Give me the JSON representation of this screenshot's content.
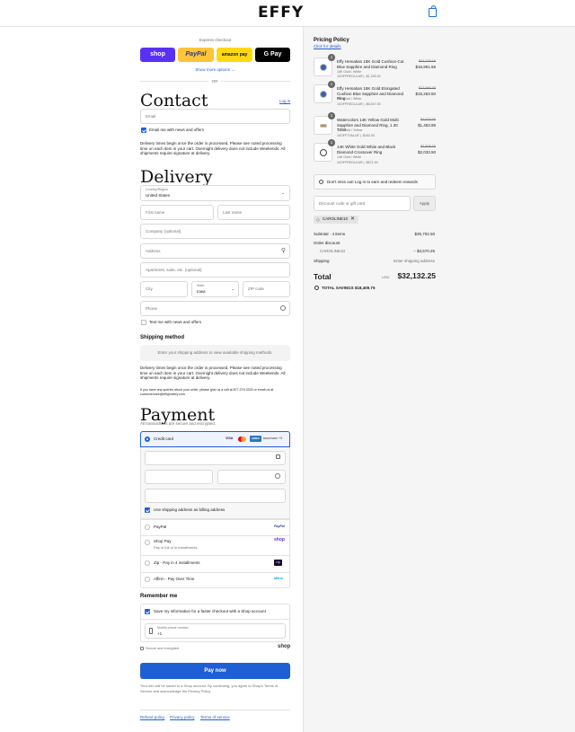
{
  "header": {
    "logo": "EFFY",
    "bag_icon": "bag-icon"
  },
  "express": {
    "title": "Express checkout",
    "buttons": [
      "shop",
      "PayPal",
      "amazon pay",
      "G Pay"
    ],
    "show_more": "Show more options →",
    "or": "OR"
  },
  "contact": {
    "title": "Contact",
    "login": "Log in",
    "email_placeholder": "Email",
    "news_label": "Email me with news and offers",
    "delivery_note": "Delivery times begin once the order is processed. Please see noted processing time on each item in your cart. Overnight delivery does not include Weekends. All shipments require signature at delivery."
  },
  "delivery": {
    "title": "Delivery",
    "country_label": "Country/Region",
    "country_value": "United States",
    "first_name": "First name",
    "last_name": "Last name",
    "company": "Company (optional)",
    "address": "Address",
    "apartment": "Apartment, suite, etc. (optional)",
    "city": "City",
    "state_label": "State",
    "state_value": "Iowa",
    "zip": "ZIP code",
    "phone": "Phone",
    "text_label": "Text me with news and offers"
  },
  "shipping": {
    "title": "Shipping method",
    "placeholder": "Enter your shipping address to view available shipping methods.",
    "note": "Delivery times begin once the order is processed. Please see noted processing time on each item in your cart. Overnight delivery does not include Weekends. All shipments require signature at delivery.",
    "question": "If you have any queries about your order, please give us a call at 877.279.3333 or email us at customercare@effyjewelry.com"
  },
  "payment": {
    "title": "Payment",
    "subtitle": "All transactions are secure and encrypted.",
    "credit_card": "Credit card",
    "card_logos": [
      "VISA",
      "MC",
      "AMEX",
      "DISCOVER",
      "+3"
    ],
    "billing_label": "Use shipping address as billing address",
    "methods": [
      {
        "label": "PayPal",
        "sub": "",
        "logo": "PayPal"
      },
      {
        "label": "Shop Pay",
        "sub": "Pay in full or in installments",
        "logo": "shop"
      },
      {
        "label": "Zip - Pay in 4 installments",
        "sub": "",
        "logo": "zip"
      },
      {
        "label": "Affirm - Pay Over Time",
        "sub": "",
        "logo": "affirm"
      }
    ]
  },
  "remember": {
    "title": "Remember me",
    "save_label": "Save my information for a faster checkout with a Shop account",
    "phone_label": "Mobile phone number",
    "phone_value": "+1",
    "secure": "Secure and encrypted",
    "shop": "shop"
  },
  "pay_button": "Pay now",
  "legal": "Your info will be saved to a Shop account. By continuing, you agree to Shop's Terms of Service and acknowledge the Privacy Policy.",
  "footer_links": [
    "Refund policy",
    "Privacy policy",
    "Terms of service"
  ],
  "summary": {
    "pricing_policy": "Pricing Policy",
    "click_details": "Click for details",
    "items": [
      {
        "qty": "1",
        "name": "Effy Hematian 18K Gold Cushion-Cut Blue Sapphire and Diamond Ring",
        "variant": "18K Gold / White",
        "code": "10OFFREGULAR | -$1,249.40",
        "old": "$24,278.19",
        "price": "$16,951.55"
      },
      {
        "qty": "1",
        "name": "Effy Hematian 18K Gold Elongated Cushion Blue Sapphire and Diamond Ring",
        "variant": "18K Gold / White",
        "code": "10OFFREGULAR | -$6,547.50",
        "old": "$17,960.00",
        "price": "$15,263.50"
      },
      {
        "qty": "1",
        "name": "Watercolors 14K Yellow Gold Multi Sapphire and Diamond Ring, 1.30 TCW",
        "variant": "14K Gold / Yellow",
        "code": "15OFFTVALUE | -$162.00",
        "old": "$1,615.00",
        "price": "$1,453.95"
      },
      {
        "qty": "1",
        "name": "14K White Gold White and Black Diamond Crossover Ring",
        "variant": "14K Gold / White",
        "code": "10OFFREGULAR | -$671.50",
        "old": "$2,506.00",
        "price": "$2,033.50"
      }
    ],
    "rewards": "Don't miss out! Log in to earn and redeem rewards",
    "discount_placeholder": "Discount code or gift card",
    "apply": "Apply",
    "code_tag": "CAROLINE10",
    "subtotal_label": "Subtotal · 4 items",
    "subtotal_value": "$35,702.50",
    "order_discount": "Order discount",
    "discount_code": "CAROLINE10",
    "discount_value": "− $3,570.25",
    "shipping_label": "Shipping",
    "shipping_value": "Enter shipping address",
    "total_label": "Total",
    "currency": "USD",
    "total_value": "$32,132.25",
    "savings": "TOTAL SAVINGS  $18,409.75"
  }
}
